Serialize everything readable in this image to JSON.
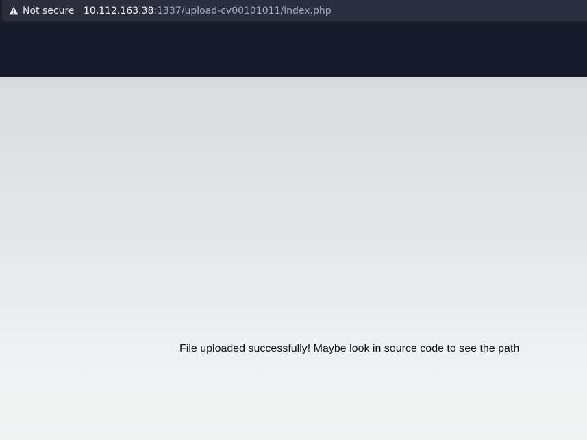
{
  "browser": {
    "security_label": "Not secure",
    "url_host": "10.112.163.38",
    "url_rest": ":1337/upload-cv00101011/index.php"
  },
  "page": {
    "message": "File uploaded successfully! Maybe look in source code to see the path"
  },
  "colors": {
    "header_bg": "#171c2a",
    "urlbar_bg": "#2b2f3d",
    "text": "#141414"
  },
  "icons": {
    "security": "warning-triangle-icon"
  }
}
